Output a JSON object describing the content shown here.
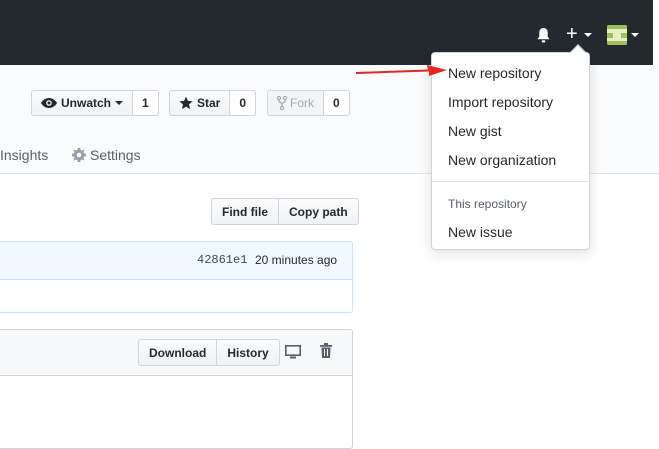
{
  "header": {
    "icons": [
      "bell-icon",
      "plus-icon",
      "avatar"
    ]
  },
  "repo_actions": {
    "watch_label": "Unwatch",
    "watch_count": "1",
    "star_label": "Star",
    "star_count": "0",
    "fork_label": "Fork",
    "fork_count": "0"
  },
  "tabs": {
    "insights": "Insights",
    "settings": "Settings"
  },
  "file_nav": {
    "find_file": "Find file",
    "copy_path": "Copy path"
  },
  "commit": {
    "sha": "42861e1",
    "time": "20 minutes ago"
  },
  "file_actions": {
    "download": "Download",
    "history": "History",
    "icons": [
      "desktop-icon",
      "trash-icon"
    ]
  },
  "create_menu": {
    "items": [
      "New repository",
      "Import repository",
      "New gist",
      "New organization"
    ],
    "section_header": "This repository",
    "repo_items": [
      "New issue"
    ]
  },
  "annotation": {
    "arrow_color": "#e8261f"
  }
}
